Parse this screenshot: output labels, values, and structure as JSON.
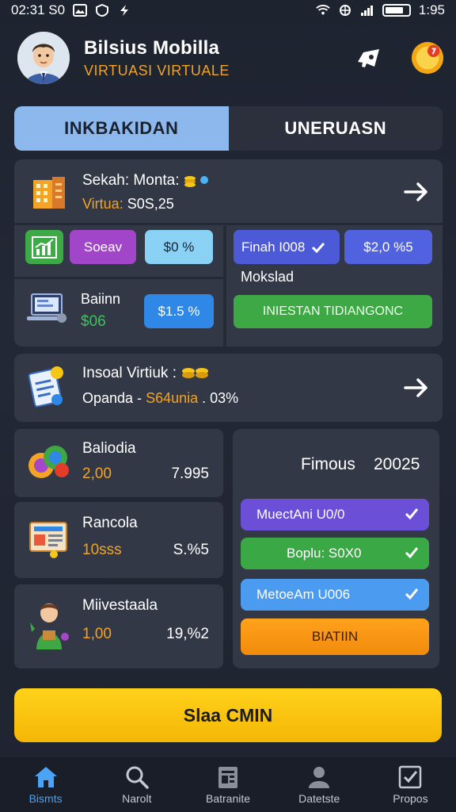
{
  "status_bar": {
    "time_left": "02:31 S0",
    "time_right": "1:95"
  },
  "header": {
    "title": "Bilsius Mobilla",
    "subtitle": "VIRTUASI VIRTUALE"
  },
  "tabs": [
    {
      "label": "INKBAKIDAN",
      "active": true
    },
    {
      "label": "UNERUASN",
      "active": false
    }
  ],
  "card1": {
    "title": "Sekah: Monta:",
    "sub_label": "Virtua:",
    "sub_value": "S0S,25",
    "pills": {
      "soeav": "Soeav",
      "pct1": "$0 %",
      "finah": "Finah I008",
      "value": "$2,0 %5"
    },
    "mokslad": "Mokslad",
    "balin": {
      "name": "Baiinn",
      "value": "$06",
      "pct": "$1.5 %"
    },
    "green_button": "INIESTAN TIDIANGONC"
  },
  "card2": {
    "title": "Insoal Virtiuk :",
    "sub_label": "Opanda -",
    "sub_value": "S64unia",
    "sub_suffix": ". 03%"
  },
  "list": [
    {
      "name": "Baliodia",
      "value": "2,00",
      "pct": "7.995"
    },
    {
      "name": "Rancola",
      "value": "10sss",
      "pct": "S.%5"
    },
    {
      "name": "Miivestaala",
      "value": "1,00",
      "pct": "19,%2"
    }
  ],
  "right_panel": {
    "title": "Fimous",
    "year": "20025",
    "options": [
      {
        "label": "MuectAni U0/0",
        "color": "#6b4fd6"
      },
      {
        "label": "Boplu: S0X0",
        "color": "#3aa845"
      },
      {
        "label": "MetoeAm U006",
        "color": "#4b9cf0"
      }
    ],
    "orange_button": "BIATIIN"
  },
  "cta": {
    "label": "Slaa CMIN"
  },
  "bottom_nav": [
    {
      "label": "Bismts",
      "icon": "home-icon",
      "active": true
    },
    {
      "label": "Narolt",
      "icon": "search-icon",
      "active": false
    },
    {
      "label": "Batranite",
      "icon": "document-icon",
      "active": false
    },
    {
      "label": "Datetste",
      "icon": "profile-icon",
      "active": false
    },
    {
      "label": "Propos",
      "icon": "checkbox-icon",
      "active": false
    }
  ]
}
